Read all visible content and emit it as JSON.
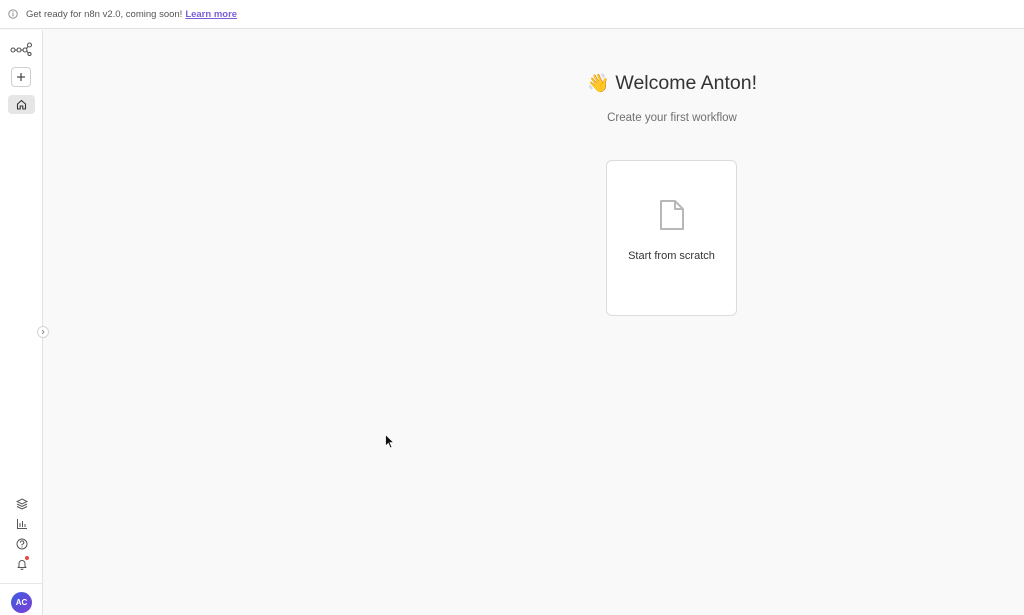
{
  "banner": {
    "message": "Get ready for n8n v2.0, coming soon!",
    "link_label": "Learn more"
  },
  "sidebar": {
    "top_icons": [
      "n8n-logo-icon",
      "plus-icon",
      "home-icon"
    ],
    "bottom_icons": [
      "templates-icon",
      "insights-icon",
      "help-icon",
      "bell-icon"
    ],
    "avatar_initials": "AC"
  },
  "main": {
    "welcome_emoji": "👋",
    "welcome_title": "Welcome Anton!",
    "subtitle": "Create your first workflow",
    "card": {
      "icon": "file-icon",
      "label": "Start from scratch"
    }
  },
  "colors": {
    "accent": "#7b5fd9",
    "background": "#f9f9f9",
    "notification_dot": "#e84a4a"
  }
}
